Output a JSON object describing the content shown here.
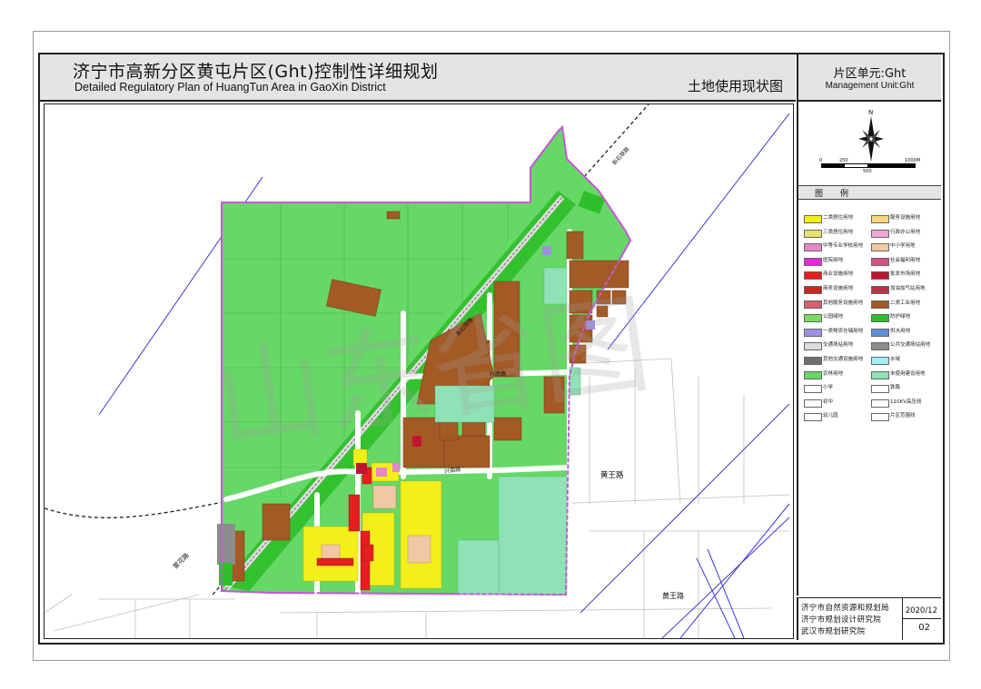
{
  "title": {
    "cn": "济宁市高新分区黄屯片区(Ght)控制性详细规划",
    "en": "Detailed Regulatory Plan of HuangTun Area in GaoXin District",
    "sheet_name": "土地使用现状图"
  },
  "unit": {
    "cn": "片区单元:Ght",
    "en": "Management Unit:Ght"
  },
  "north": {
    "letter": "N"
  },
  "scale": {
    "labels": [
      "0",
      "250",
      "500",
      "1000M"
    ]
  },
  "legend": {
    "header_a": "图",
    "header_b": "例",
    "items": [
      {
        "label": "二类居住用地",
        "color": "#f2ef19"
      },
      {
        "label": "服务设施用地",
        "color": "#f7d77a"
      },
      {
        "label": "三类居住用地",
        "color": "#e7e26a"
      },
      {
        "label": "行政办公用地",
        "color": "#f2a6d6"
      },
      {
        "label": "中等专业学校用地",
        "color": "#e887c8"
      },
      {
        "label": "中小学用地",
        "color": "#f0c8a4"
      },
      {
        "label": "医院用地",
        "color": "#e52adb"
      },
      {
        "label": "社会福利用地",
        "color": "#d6508a"
      },
      {
        "label": "商业设施用地",
        "color": "#e51f1f"
      },
      {
        "label": "批发市场用地",
        "color": "#c21530"
      },
      {
        "label": "商务设施用地",
        "color": "#c9271c"
      },
      {
        "label": "加油加气站用地",
        "color": "#b6344a"
      },
      {
        "label": "其他服务设施用地",
        "color": "#d85f6f"
      },
      {
        "label": "二类工业用地",
        "color": "#a35a24"
      },
      {
        "label": "公园绿地",
        "color": "#7cdc62"
      },
      {
        "label": "防护绿地",
        "color": "#2fbf2a"
      },
      {
        "label": "一类物流仓储用地",
        "color": "#9f8fe6"
      },
      {
        "label": "供水用地",
        "color": "#5c8fd8"
      },
      {
        "label": "交通场站用地",
        "color": "#dcdcdc"
      },
      {
        "label": "公共交通场站用地",
        "color": "#8c8c8c"
      },
      {
        "label": "其他交通设施用地",
        "color": "#6f6f6f"
      },
      {
        "label": "水域",
        "color": "#9ff2f2"
      },
      {
        "label": "农林用地",
        "color": "#66d866"
      },
      {
        "label": "未使用建设用地",
        "color": "#8fe2b6"
      },
      {
        "label": "小学",
        "color": "#ffffff"
      },
      {
        "label": "铁路",
        "color": "#ffffff"
      },
      {
        "label": "初中",
        "color": "#ffffff"
      },
      {
        "label": "110KV高压线",
        "color": "#ffffff"
      },
      {
        "label": "幼儿园",
        "color": "#ffffff"
      },
      {
        "label": "片区范围线",
        "color": "#ffffff"
      }
    ]
  },
  "map": {
    "roads": [
      "黄王路",
      "黄王路",
      "蒙花路",
      "新石铁路",
      "新石铁路",
      "兴南路",
      "兴南路"
    ],
    "watermark": "山东省图"
  },
  "footer": {
    "org1": "济宁市自然资源和规划局",
    "org2": "济宁市规划设计研究院",
    "org3": "武汉市规划研究院",
    "date": "2020/12",
    "page": "02"
  },
  "colors": {
    "agri": "#66d866",
    "industrial": "#a35a24",
    "residential": "#f2ef19",
    "commercial": "#e51f1f",
    "unused": "#8fe2b6",
    "boundary": "#c25bd4",
    "powerline": "#3a3ad6"
  }
}
